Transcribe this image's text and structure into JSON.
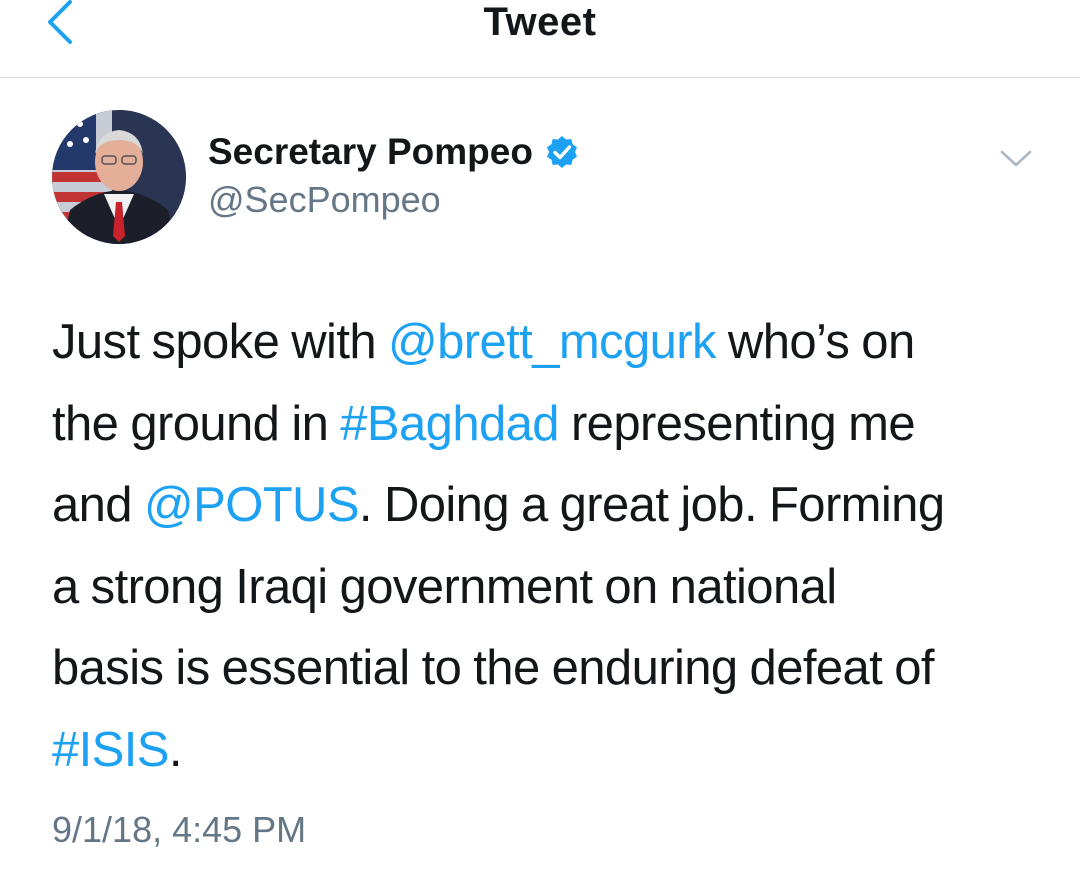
{
  "navbar": {
    "title": "Tweet"
  },
  "author": {
    "display_name": "Secretary Pompeo",
    "handle": "@SecPompeo",
    "verified": true
  },
  "tweet": {
    "lines": [
      [
        {
          "t": "Just spoke with "
        },
        {
          "t": "@brett_mcgurk",
          "link": true
        },
        {
          "t": " who’s on"
        }
      ],
      [
        {
          "t": "the ground in "
        },
        {
          "t": "#Baghdad",
          "link": true
        },
        {
          "t": " representing me"
        }
      ],
      [
        {
          "t": "and "
        },
        {
          "t": "@POTUS",
          "link": true
        },
        {
          "t": ". Doing a great job. Forming"
        }
      ],
      [
        {
          "t": "a strong Iraqi government on national"
        }
      ],
      [
        {
          "t": "basis is essential to the enduring defeat of"
        }
      ],
      [
        {
          "t": "#ISIS",
          "link": true
        },
        {
          "t": "."
        }
      ]
    ],
    "timestamp": "9/1/18, 4:45 PM"
  },
  "colors": {
    "link": "#1da1f2",
    "text": "#14171a",
    "secondary": "#657786",
    "divider": "#d6d9dc"
  },
  "icons": {
    "back": "chevron-left-icon",
    "verified": "verified-badge-icon",
    "more": "chevron-down-icon"
  }
}
